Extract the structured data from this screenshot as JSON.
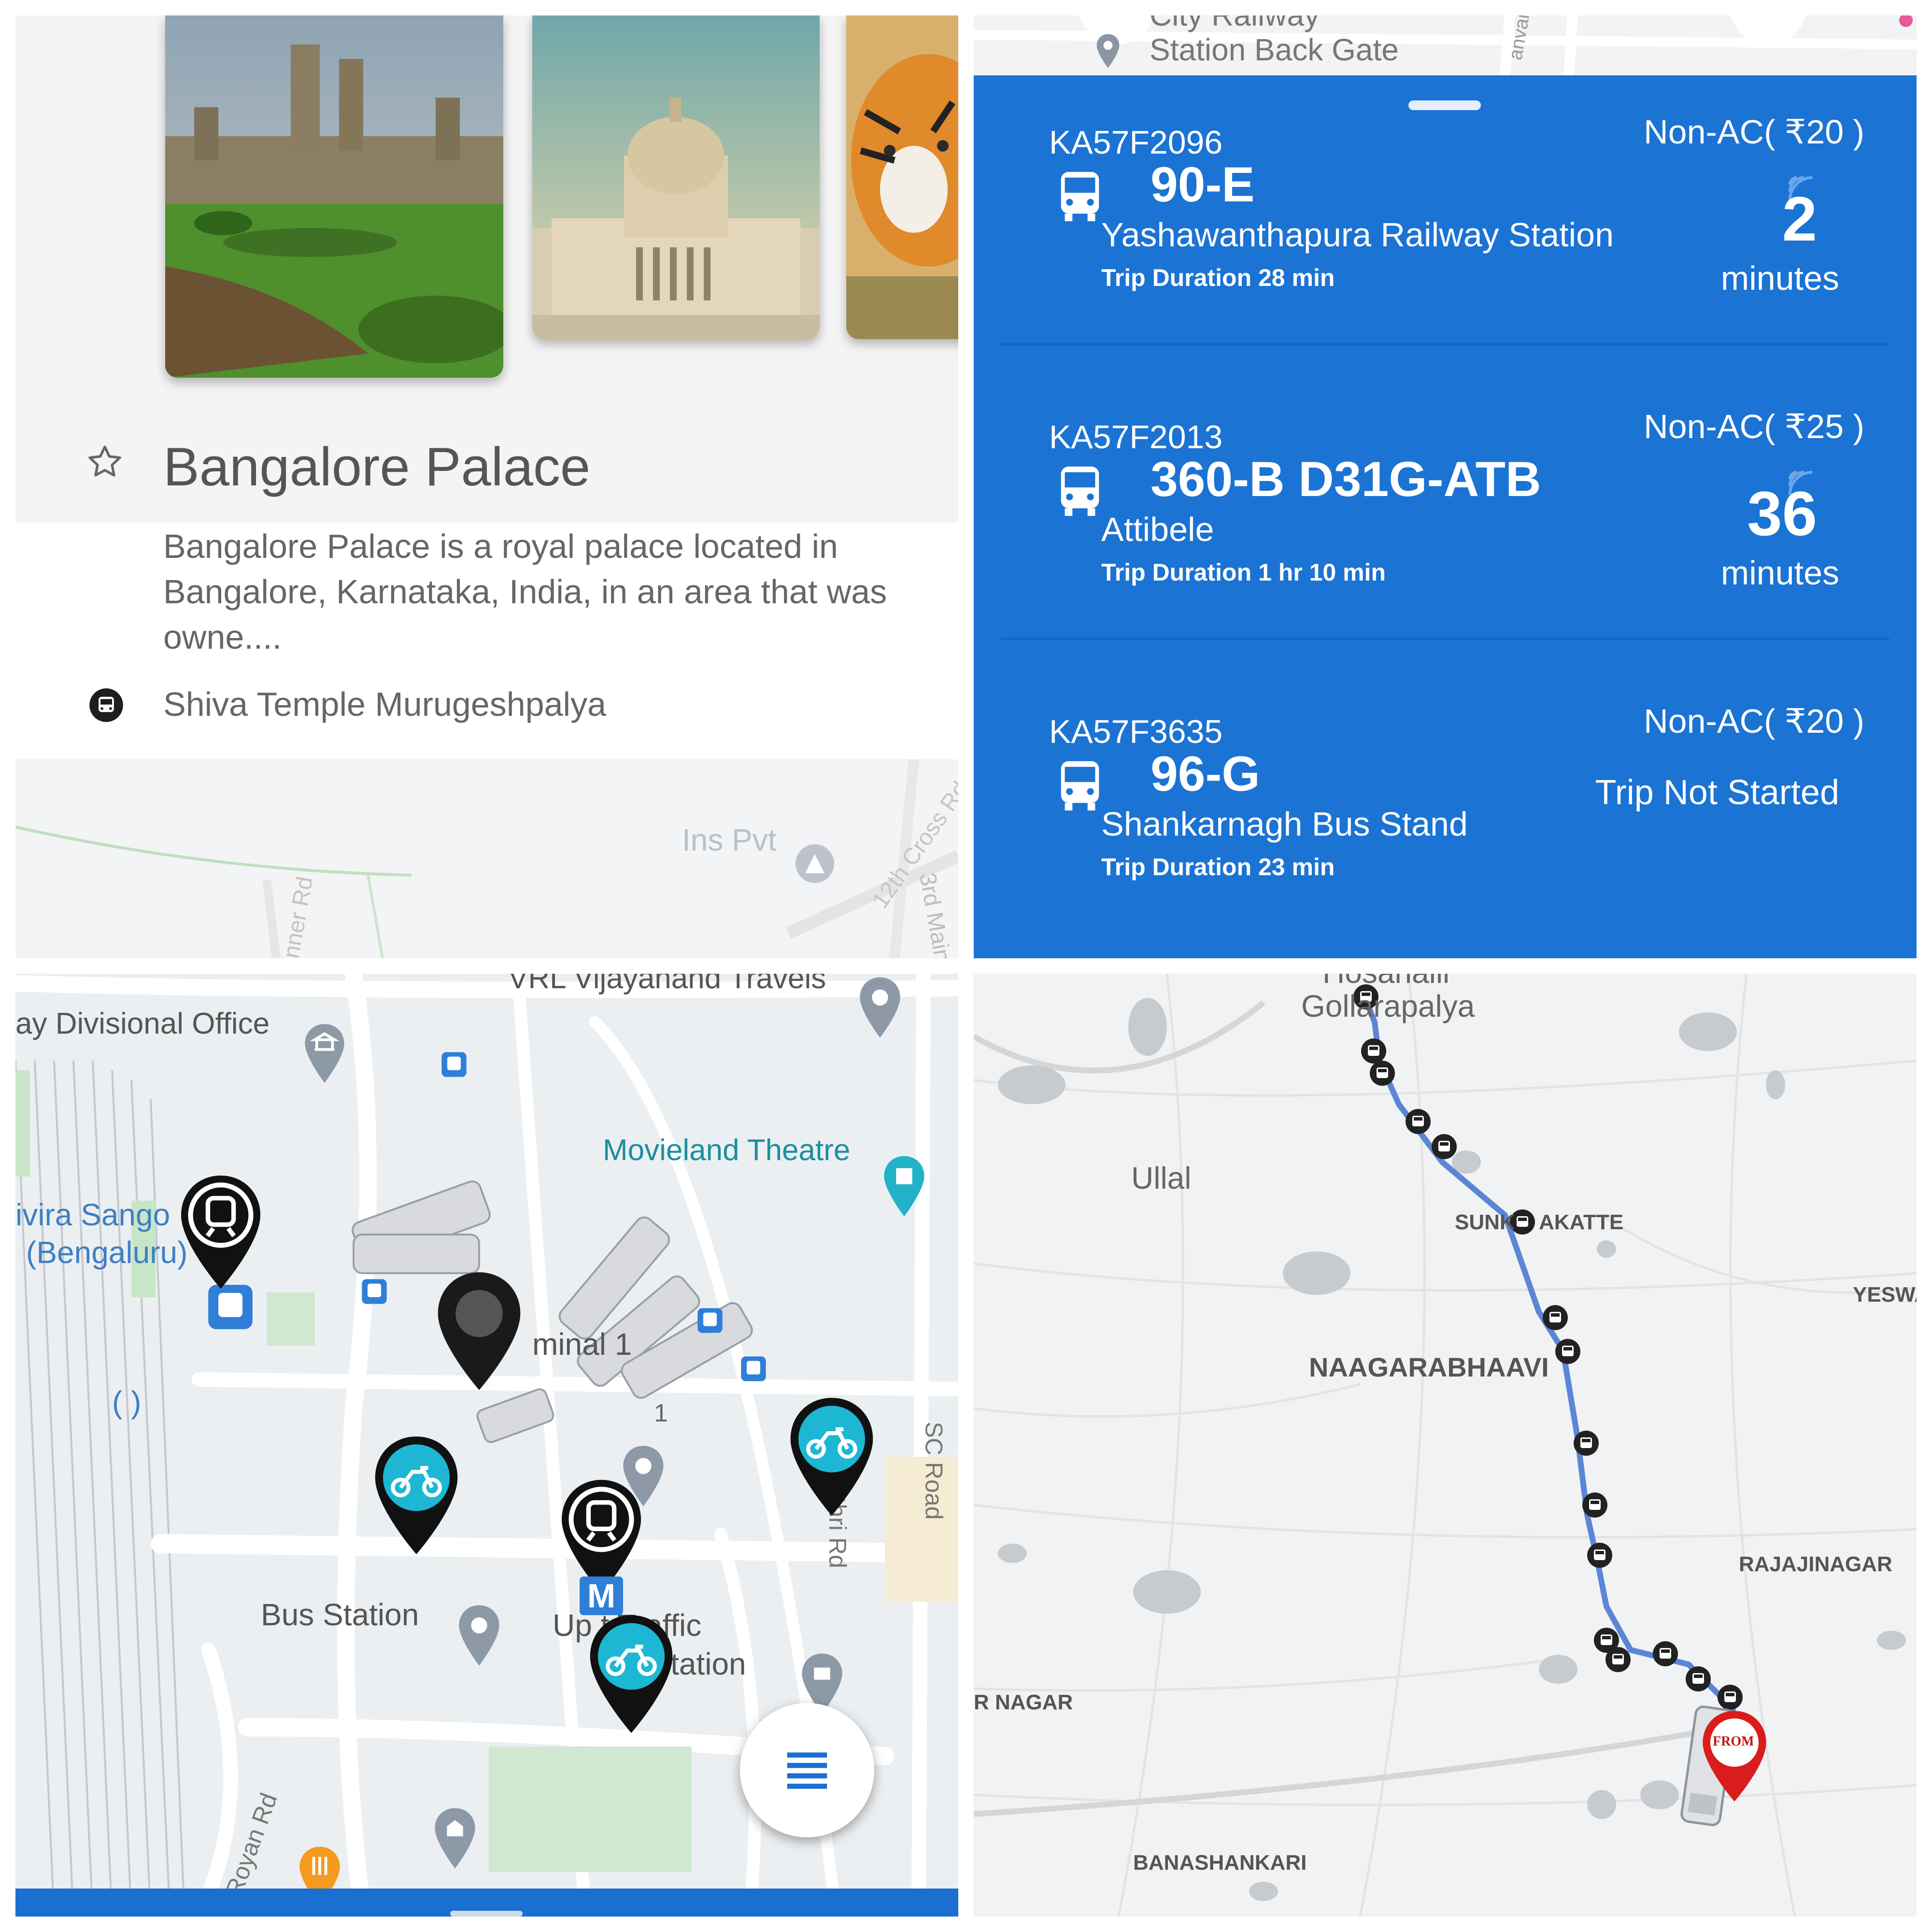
{
  "place_panel": {
    "title": "Bangalore Palace",
    "description": "Bangalore Palace is a royal palace located in Bangalore, Karnataka, India, in an area that was owne....",
    "nearest_stop": "Shiva Temple Murugeshpalya",
    "map_labels": {
      "poi": "Ins Pvt",
      "road_1": "12th Cross Rd",
      "road_2": "3rd Main",
      "road_3": "nner Rd"
    },
    "photos": [
      "bangalore-palace-photo",
      "vidhana-soudha-photo",
      "tiger-photo"
    ]
  },
  "arrivals_panel": {
    "map_header": {
      "line1": "City Railway",
      "line2": "Station Back Gate",
      "road": "anvar"
    },
    "buses": [
      {
        "reg": "KA57F2096",
        "fare": "Non-AC( ₹20 )",
        "route": "90-E",
        "destination": "Yashawanthapura Railway Station",
        "duration": "Trip Duration 28 min",
        "eta_value": "2",
        "eta_unit": "minutes"
      },
      {
        "reg": "KA57F2013",
        "fare": "Non-AC( ₹25 )",
        "route": "360-B D31G-ATB",
        "destination": "Attibele",
        "duration": "Trip Duration 1 hr 10 min",
        "eta_value": "36",
        "eta_unit": "minutes"
      },
      {
        "reg": "KA57F3635",
        "fare": "Non-AC( ₹20 )",
        "route": "96-G",
        "destination": "Shankarnagh Bus Stand",
        "duration": "Trip Duration 23 min",
        "status": "Trip Not Started"
      }
    ]
  },
  "station_map": {
    "labels": {
      "vrl": "VRL Vijayanand Travels",
      "divisional": "ay Divisional Office",
      "movieland": "Movieland Theatre",
      "sango1": "ivira Sango",
      "sango2": "(Bengaluru)",
      "terminal": "minal 1",
      "one": "1",
      "paren": "(     )",
      "bus_station": "Bus Station",
      "traffic1": "Up    t Traffic",
      "traffic2": "e Station",
      "sc_road": "SC Road",
      "anvanthri": "anvanthri Rd",
      "royan": "M Royan Rd",
      "metro_m": "M"
    },
    "colors": {
      "metro_pin": "#111111",
      "bike_pin": "#1db7d4"
    }
  },
  "route_map": {
    "labels": {
      "hosahalli": "Hosahalli",
      "gollarapalya": "Gollarapalya",
      "ullal": "Ullal",
      "sunkadakatte_a": "SUNK",
      "sunkadakatte_b": "AKATTE",
      "yeswa": "YESWA",
      "naagarabhaavi": "NAAGARABHAAVI",
      "rajajinagar": "RAJAJINAGAR",
      "rnagar": "R NAGAR",
      "banashankari": "BANASHANKARI",
      "from_marker": "FROM"
    },
    "colors": {
      "route": "#5b86d6",
      "marker": "#d91c1c"
    }
  }
}
